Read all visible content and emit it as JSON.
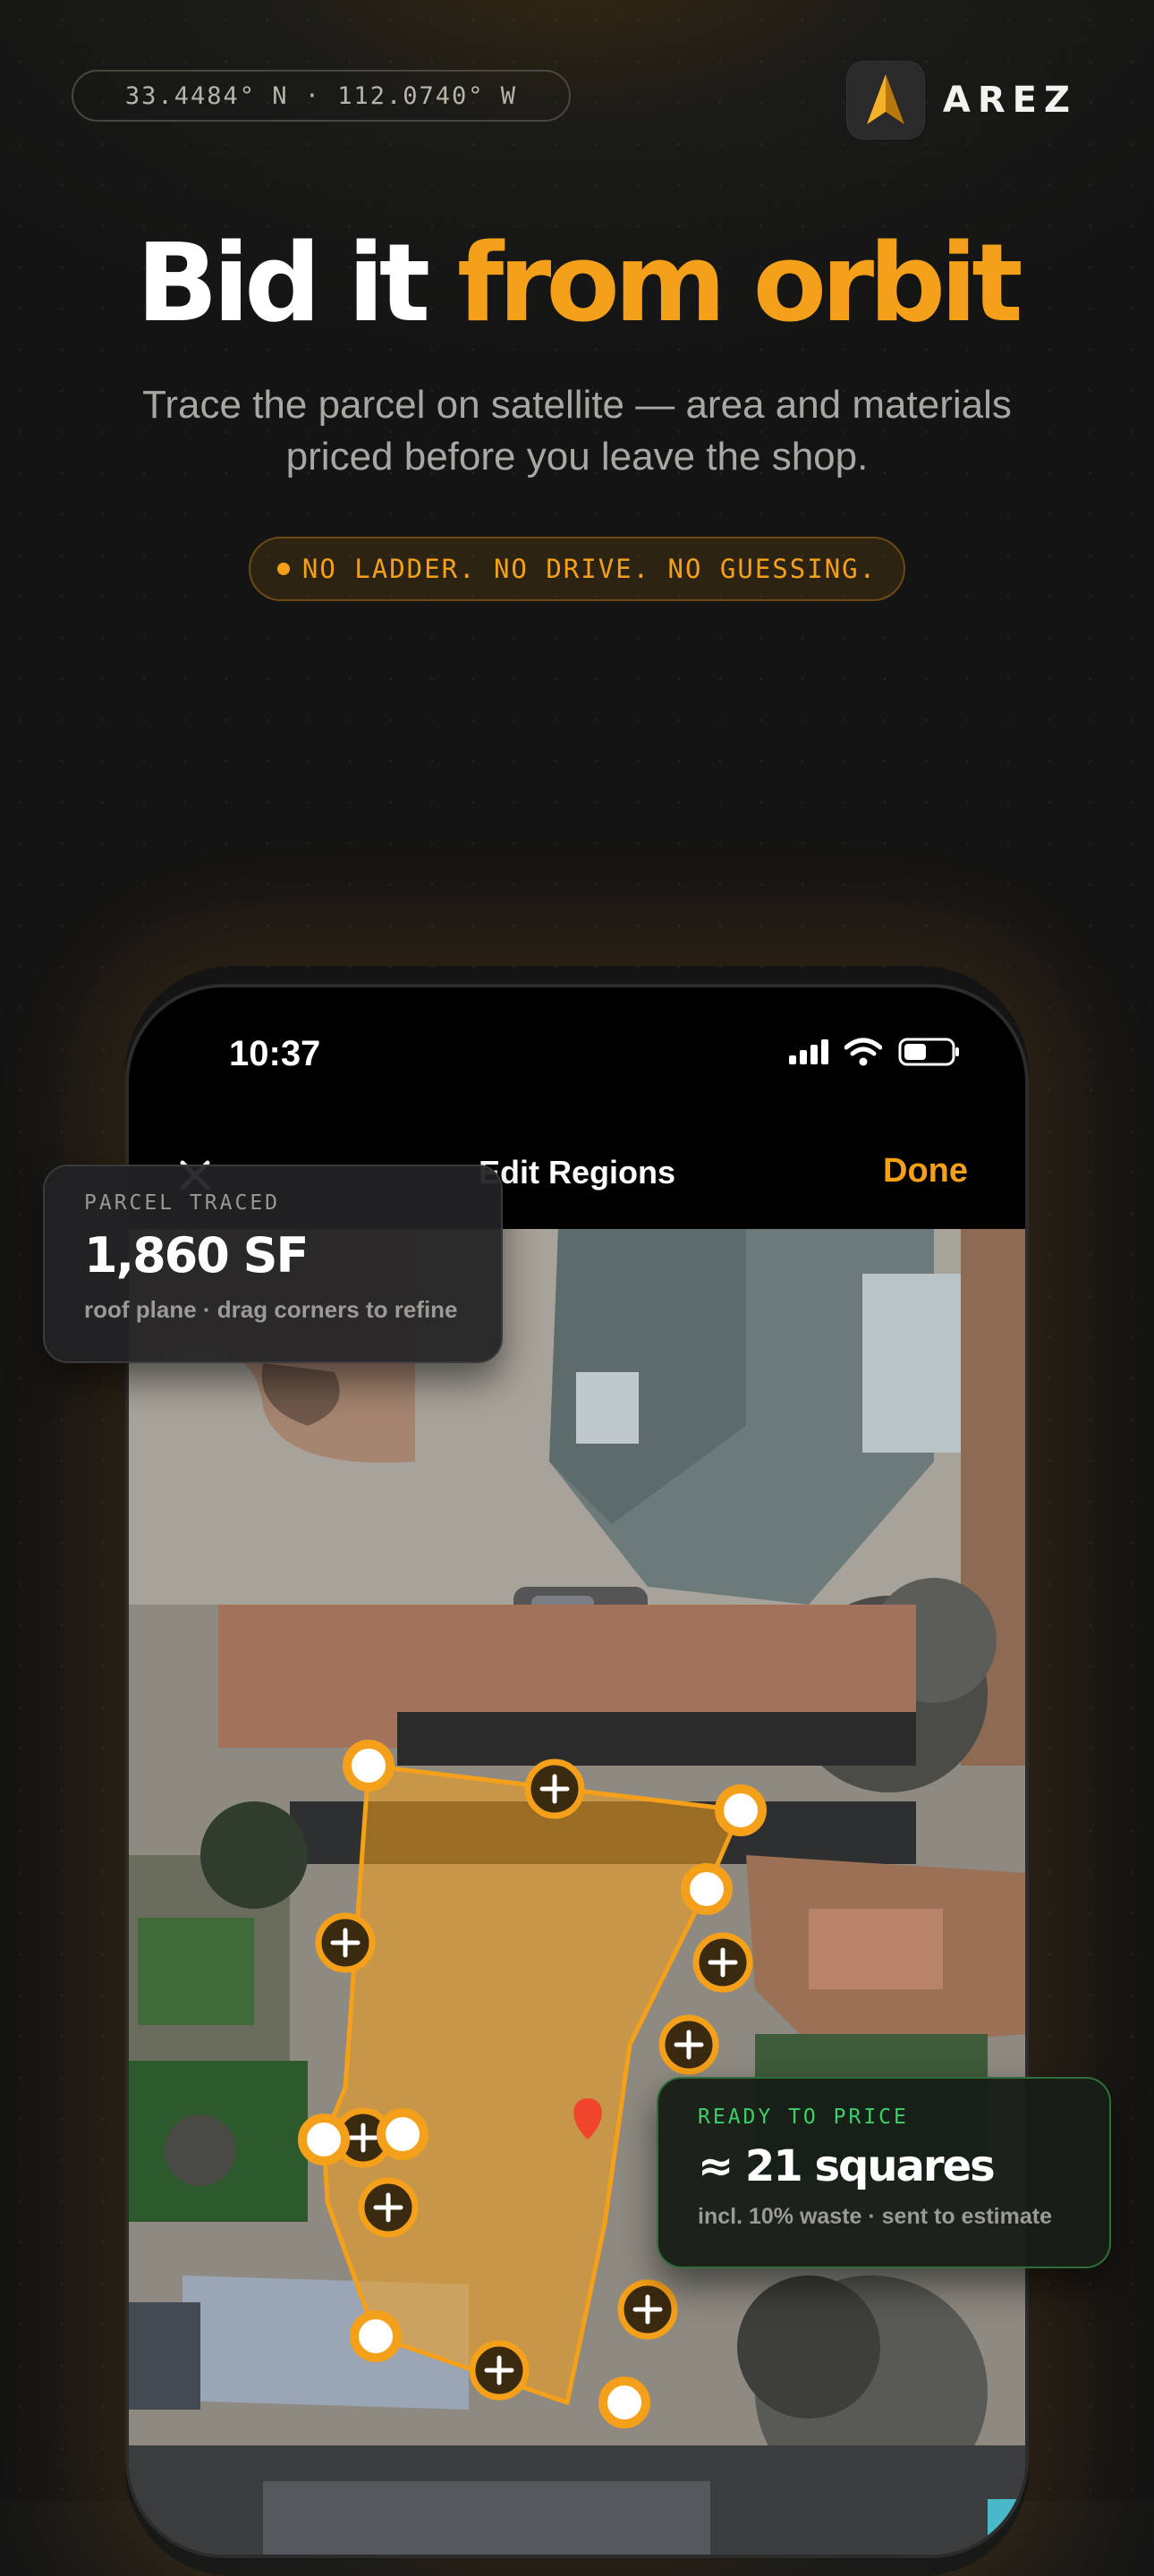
{
  "header": {
    "coordinates": "33.4484° N · 112.0740° W",
    "brand_name": "AREZ"
  },
  "hero": {
    "headline_white": "Bid it",
    "headline_orange": "from orbit",
    "subtitle": "Trace the parcel on satellite — area and materials priced before you leave the shop.",
    "tagline": "NO LADDER. NO DRIVE. NO GUESSING."
  },
  "phone": {
    "status_time": "10:37",
    "nav_title": "Edit Regions",
    "nav_done": "Done"
  },
  "parcel_card": {
    "label": "PARCEL TRACED",
    "value": "1,860 SF",
    "note": "roof plane · drag corners to refine"
  },
  "price_card": {
    "label": "READY TO PRICE",
    "value": "≈ 21 squares",
    "note": "incl. 10% waste · sent to estimate"
  },
  "colors": {
    "accent": "#f5a01a",
    "success": "#3fcf6a",
    "background": "#141414"
  }
}
